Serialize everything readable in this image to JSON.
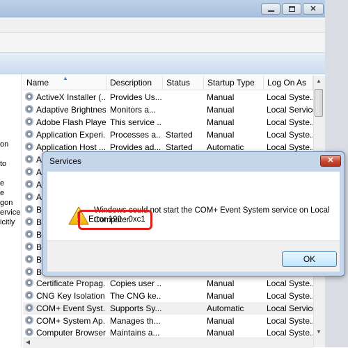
{
  "dialog": {
    "title": "Services",
    "close_label": "✕",
    "message": "Windows could not start the COM+ Event System service on Local Computer.",
    "error": "Error 190 : 0xc1",
    "ok_label": "OK"
  },
  "table": {
    "columns": [
      "Name",
      "Description",
      "Status",
      "Startup Type",
      "Log On As"
    ],
    "rows": [
      {
        "name": "ActiveX Installer (...",
        "description": "Provides Us...",
        "status": "",
        "startup": "Manual",
        "logon": "Local Syste..."
      },
      {
        "name": "Adaptive Brightness",
        "description": "Monitors a...",
        "status": "",
        "startup": "Manual",
        "logon": "Local Service"
      },
      {
        "name": "Adobe Flash Playe...",
        "description": "This service ...",
        "status": "",
        "startup": "Manual",
        "logon": "Local Syste..."
      },
      {
        "name": "Application Experi...",
        "description": "Processes a...",
        "status": "Started",
        "startup": "Manual",
        "logon": "Local Syste..."
      },
      {
        "name": "Application Host ...",
        "description": "Provides ad...",
        "status": "Started",
        "startup": "Automatic",
        "logon": "Local Syste..."
      }
    ],
    "hidden_rows": [
      "A",
      "A",
      "A",
      "A",
      "B",
      "B",
      "B",
      "B",
      "B",
      "B"
    ],
    "bottom_rows": [
      {
        "name": "Certificate Propag...",
        "description": "Copies user ...",
        "status": "",
        "startup": "Manual",
        "logon": "Local Syste..."
      },
      {
        "name": "CNG Key Isolation",
        "description": "The CNG ke...",
        "status": "",
        "startup": "Manual",
        "logon": "Local Syste..."
      },
      {
        "name": "COM+ Event Syst...",
        "description": "Supports Sy...",
        "status": "",
        "startup": "Automatic",
        "logon": "Local Service"
      },
      {
        "name": "COM+ System Ap...",
        "description": "Manages th...",
        "status": "",
        "startup": "Manual",
        "logon": "Local Syste..."
      },
      {
        "name": "Computer Browser",
        "description": "Maintains a...",
        "status": "",
        "startup": "Manual",
        "logon": "Local Syste..."
      }
    ]
  },
  "left_pane": {
    "lines": [
      "on",
      "to",
      "e",
      "e",
      "gon",
      "ervice",
      "icitly"
    ]
  },
  "icons": {
    "minimize": "minimize-icon",
    "maximize": "maximize-icon",
    "close": "close-icon",
    "warning": "warning-icon",
    "service": "gear-icon"
  },
  "colors": {
    "highlight_border": "#e0201a",
    "dialog_frame": "#c5d6eb",
    "close_button": "#c8472f"
  }
}
